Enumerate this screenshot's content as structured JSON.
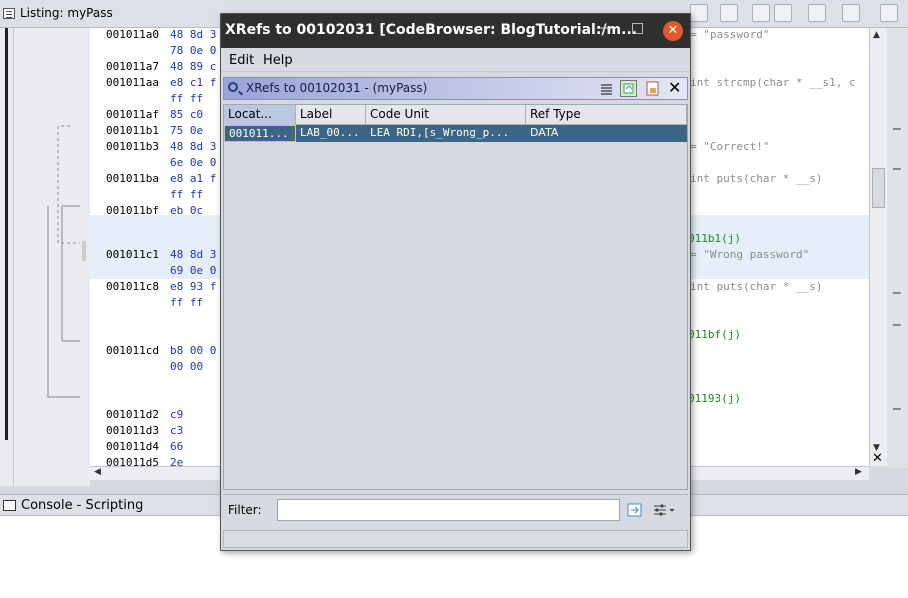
{
  "listing": {
    "title": "Listing:  myPass",
    "rows": [
      {
        "addr": "001011a0",
        "bytes": "48 8d 3",
        "comment": "= \"password\""
      },
      {
        "addr": "",
        "bytes": "78 0e 0",
        "comment": ""
      },
      {
        "addr": "001011a7",
        "bytes": "48 89 c",
        "comment": ""
      },
      {
        "addr": "001011aa",
        "bytes": "e8 c1 f",
        "comment": "int strcmp(char * __s1, c"
      },
      {
        "addr": "",
        "bytes": "ff ff",
        "comment": ""
      },
      {
        "addr": "001011af",
        "bytes": "85 c0",
        "comment": ""
      },
      {
        "addr": "001011b1",
        "bytes": "75 0e",
        "comment": ""
      },
      {
        "addr": "001011b3",
        "bytes": "48 8d 3",
        "comment": "= \"Correct!\""
      },
      {
        "addr": "",
        "bytes": "6e 0e 0",
        "comment": ""
      },
      {
        "addr": "001011ba",
        "bytes": "e8 a1 f",
        "comment": "int puts(char * __s)"
      },
      {
        "addr": "",
        "bytes": "ff ff",
        "comment": ""
      },
      {
        "addr": "001011bf",
        "bytes": "eb 0c",
        "comment": ""
      },
      {
        "addr": "001011c1",
        "bytes": "48 8d 3",
        "comment": "= \"Wrong password\""
      },
      {
        "addr": "",
        "bytes": "69 0e 0",
        "comment": ""
      },
      {
        "addr": "001011c8",
        "bytes": "e8 93 f",
        "comment": "int puts(char * __s)"
      },
      {
        "addr": "",
        "bytes": "ff ff",
        "comment": ""
      },
      {
        "addr": "001011cd",
        "bytes": "b8 00 0",
        "comment": ""
      },
      {
        "addr": "",
        "bytes": "00 00",
        "comment": ""
      },
      {
        "addr": "001011d2",
        "bytes": "c9",
        "comment": ""
      },
      {
        "addr": "001011d3",
        "bytes": "c3",
        "comment": ""
      },
      {
        "addr": "001011d4",
        "bytes": "66",
        "comment": ""
      },
      {
        "addr": "001011d5",
        "bytes": "2e",
        "comment": ""
      }
    ],
    "xrefs": [
      "011b1(j)",
      "011bf(j)",
      "01193(j)"
    ]
  },
  "console": {
    "title": "Console - Scripting"
  },
  "dialog": {
    "title": "XRefs to 00102031 [CodeBrowser: BlogTutorial:/m...",
    "minimize": "—",
    "maximize": "□",
    "close": "✕",
    "menu": {
      "edit": "Edit",
      "help": "Help"
    },
    "subtitle": "XRefs to 00102031 - (myPass)",
    "columns": [
      "Locat...",
      "Label",
      "Code Unit",
      "Ref Type"
    ],
    "rows": [
      {
        "location": "001011...",
        "label": "LAB_00...",
        "code_unit": "LEA RDI,[s_Wrong_p...",
        "ref_type": "DATA"
      }
    ],
    "filter_label": "Filter:",
    "filter_value": ""
  },
  "colors": {
    "selected_row": "#3b6688",
    "title_bg": "#2f2f2f",
    "close_btn": "#e05a2b",
    "bytes": "#1a38b8",
    "xref": "#1c8a1c"
  },
  "icons": [
    "list-icon",
    "search-icon",
    "close-icon",
    "filter-options-icon",
    "refresh-icon",
    "snapshot-icon",
    "export-icon"
  ]
}
